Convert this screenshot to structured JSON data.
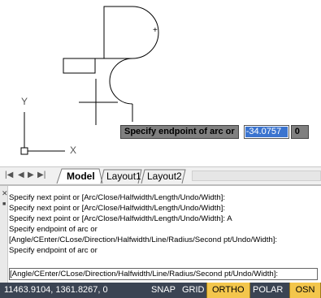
{
  "dynamic_input": {
    "prompt": "Specify endpoint of arc or",
    "value": "-34.0757",
    "second_value": "0"
  },
  "ucs_icon": {
    "y_label": "Y",
    "x_label": "X"
  },
  "layout_tabs": {
    "tabs": [
      {
        "label": "Model",
        "active": true
      },
      {
        "label": "Layout1",
        "active": false
      },
      {
        "label": "Layout2",
        "active": false
      }
    ]
  },
  "command_window": {
    "history": [
      "Specify next point or [Arc/Close/Halfwidth/Length/Undo/Width]:",
      "Specify next point or [Arc/Close/Halfwidth/Length/Undo/Width]:",
      "Specify next point or [Arc/Close/Halfwidth/Length/Undo/Width]: A",
      "Specify endpoint of arc or",
      "[Angle/CEnter/CLose/Direction/Halfwidth/Line/Radius/Second pt/Undo/Width]:",
      "Specify endpoint of arc or"
    ],
    "current_line": "[Angle/CEnter/CLose/Direction/Halfwidth/Line/Radius/Second pt/Undo/Width]:"
  },
  "status_bar": {
    "coordinates": "11463.9104, 1361.8267, 0",
    "toggles": [
      {
        "label": "SNAP",
        "on": false
      },
      {
        "label": "GRID",
        "on": false
      },
      {
        "label": "ORTHO",
        "on": true
      },
      {
        "label": "POLAR",
        "on": false
      },
      {
        "label": "OSN",
        "on": true
      }
    ]
  },
  "colors": {
    "status_bg": "#3b4453",
    "toggle_on": "#f3c64c",
    "selection": "#3b74cf"
  }
}
